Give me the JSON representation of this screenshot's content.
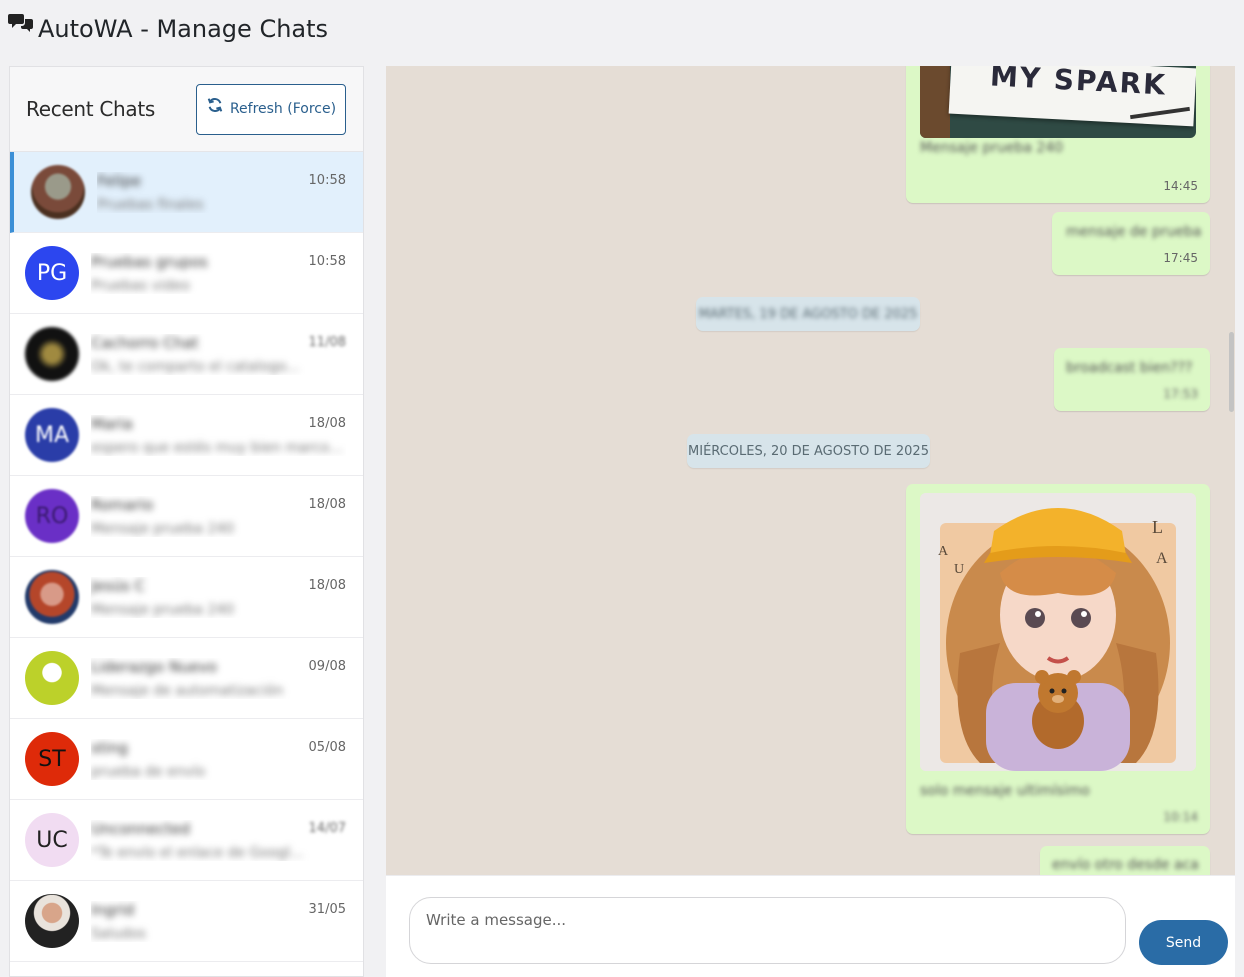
{
  "app": {
    "title": "AutoWA - Manage Chats"
  },
  "sidebar": {
    "title": "Recent Chats",
    "refresh_label": "Refresh (Force)",
    "chats": [
      {
        "initials": "",
        "name": "Felipe",
        "preview": "Pruebas finales",
        "time": "10:58",
        "avatar_color": "#7a5a4a"
      },
      {
        "initials": "PG",
        "name": "Pruebas grupos",
        "preview": "Pruebas video",
        "time": "10:58",
        "avatar_color": "#2c46ef"
      },
      {
        "initials": "",
        "name": "Cachorro Chat",
        "preview": "Ok, te comparto el catalogo...",
        "time": "11/08",
        "avatar_color": "#111111"
      },
      {
        "initials": "MA",
        "name": "Maria",
        "preview": "espero que estés muy bien marcos, felici...",
        "time": "18/08",
        "avatar_color": "#2a3da8"
      },
      {
        "initials": "RO",
        "name": "Romario",
        "preview": "Mensaje prueba 240",
        "time": "18/08",
        "avatar_color": "#6a2fc6"
      },
      {
        "initials": "",
        "name": "Jesús C",
        "preview": "Mensaje prueba 240",
        "time": "18/08",
        "avatar_color": "#b5462a"
      },
      {
        "initials": "",
        "name": "Liderazgo Nuevo",
        "preview": "Mensaje de automatización",
        "time": "09/08",
        "avatar_color": "#bcd12a"
      },
      {
        "initials": "ST",
        "name": "sting",
        "preview": "prueba de envío",
        "time": "05/08",
        "avatar_color": "#de2a09"
      },
      {
        "initials": "UC",
        "name": "Unconnected",
        "preview": "*Te envío el enlace de Googl...",
        "time": "14/07",
        "avatar_color": "#f1dcf2"
      },
      {
        "initials": "",
        "name": "Ingrid",
        "preview": "Saludos",
        "time": "31/05",
        "avatar_color": "#444444"
      }
    ]
  },
  "conversation": {
    "messages": [
      {
        "kind": "image",
        "text": "Mensaje prueba 240",
        "image_caption": "MY SPARK",
        "time": "14:45"
      },
      {
        "kind": "text",
        "text": "mensaje de prueba",
        "time": "17:45"
      },
      {
        "kind": "date",
        "text": "MARTES, 19 DE AGOSTO DE 2025"
      },
      {
        "kind": "text",
        "text": "broadcast bien???",
        "time": "17:53"
      },
      {
        "kind": "date",
        "text": "MIÉRCOLES, 20 DE AGOSTO DE 2025"
      },
      {
        "kind": "image",
        "text": "solo mensaje ultimísimo",
        "time": "10:14"
      },
      {
        "kind": "text",
        "text": "envío otro desde aca",
        "time": ""
      }
    ],
    "composer": {
      "placeholder": "Write a message...",
      "send_label": "Send"
    }
  },
  "icons": {
    "logo": "chat-bubbles-icon",
    "refresh": "refresh-icon"
  },
  "colors": {
    "accent": "#2a6ca6",
    "bubble": "#dcf8c6",
    "chat_bg": "#e5ddd5",
    "active_row": "#e2f0fc"
  }
}
